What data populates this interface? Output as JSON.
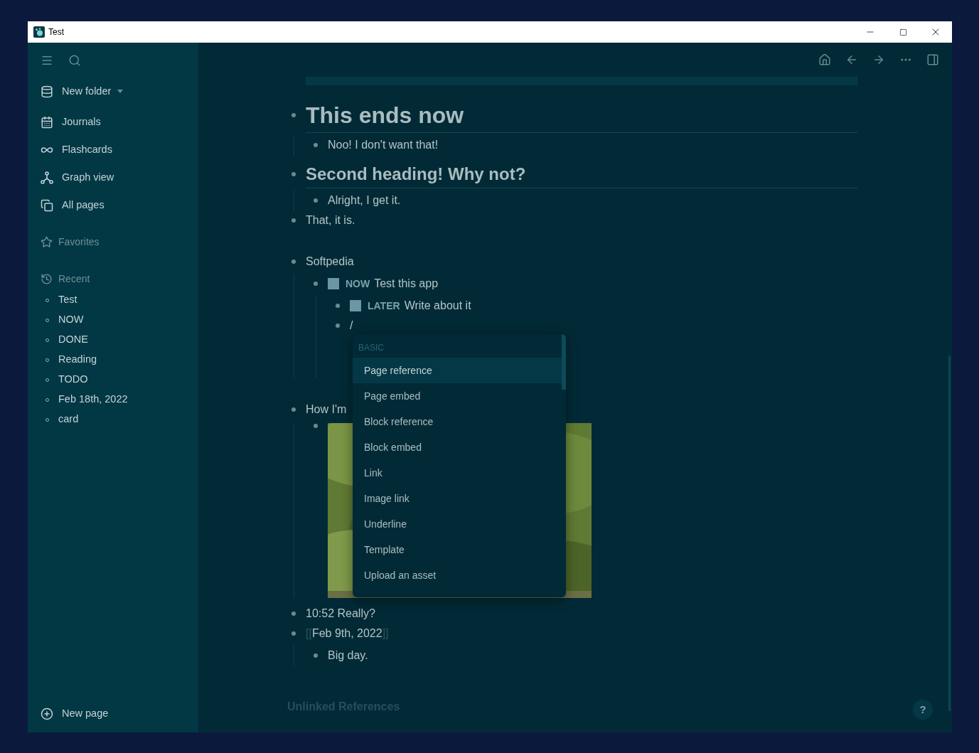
{
  "window": {
    "title": "Test"
  },
  "sidebar": {
    "folder": {
      "label": "New folder"
    },
    "nav": [
      {
        "label": "Journals"
      },
      {
        "label": "Flashcards"
      },
      {
        "label": "Graph view"
      },
      {
        "label": "All pages"
      }
    ],
    "favorites": {
      "label": "Favorites"
    },
    "recent": {
      "label": "Recent",
      "items": [
        "Test",
        "NOW",
        "DONE",
        "Reading",
        "TODO",
        "Feb 18th, 2022",
        "card"
      ]
    },
    "new_page": {
      "label": "New page"
    }
  },
  "blocks": [
    {
      "kind": "heading1",
      "text": "This ends now",
      "children": [
        {
          "kind": "text",
          "text": "Noo! I don't want that!"
        }
      ]
    },
    {
      "kind": "heading2",
      "text": "Second heading! Why not?",
      "children": [
        {
          "kind": "text",
          "text": "Alright, I get it."
        }
      ]
    },
    {
      "kind": "text",
      "text": "That, it is."
    },
    {
      "kind": "text",
      "text": "Softpedia",
      "children": [
        {
          "kind": "task",
          "marker": "NOW",
          "checked": false,
          "text": "Test this app",
          "children": [
            {
              "kind": "task",
              "marker": "LATER",
              "checked": false,
              "text": "Write about it"
            },
            {
              "kind": "slash",
              "text": "/"
            }
          ]
        }
      ]
    },
    {
      "kind": "text",
      "text": "How I'm"
    },
    {
      "kind": "text",
      "text": "10:52 Really?"
    },
    {
      "kind": "page_ref",
      "open": "[[",
      "text": "Feb 9th, 2022",
      "close": "]]",
      "children": [
        {
          "kind": "text",
          "text": "Big day."
        }
      ]
    }
  ],
  "command_menu": {
    "section": "BASIC",
    "items": [
      {
        "label": "Page reference",
        "selected": true
      },
      {
        "label": "Page embed",
        "selected": false
      },
      {
        "label": "Block reference",
        "selected": false
      },
      {
        "label": "Block embed",
        "selected": false
      },
      {
        "label": "Link",
        "selected": false
      },
      {
        "label": "Image link",
        "selected": false
      },
      {
        "label": "Underline",
        "selected": false
      },
      {
        "label": "Template",
        "selected": false
      },
      {
        "label": "Upload an asset",
        "selected": false
      }
    ]
  },
  "unlinked_references": "Unlinked References",
  "help": "?"
}
